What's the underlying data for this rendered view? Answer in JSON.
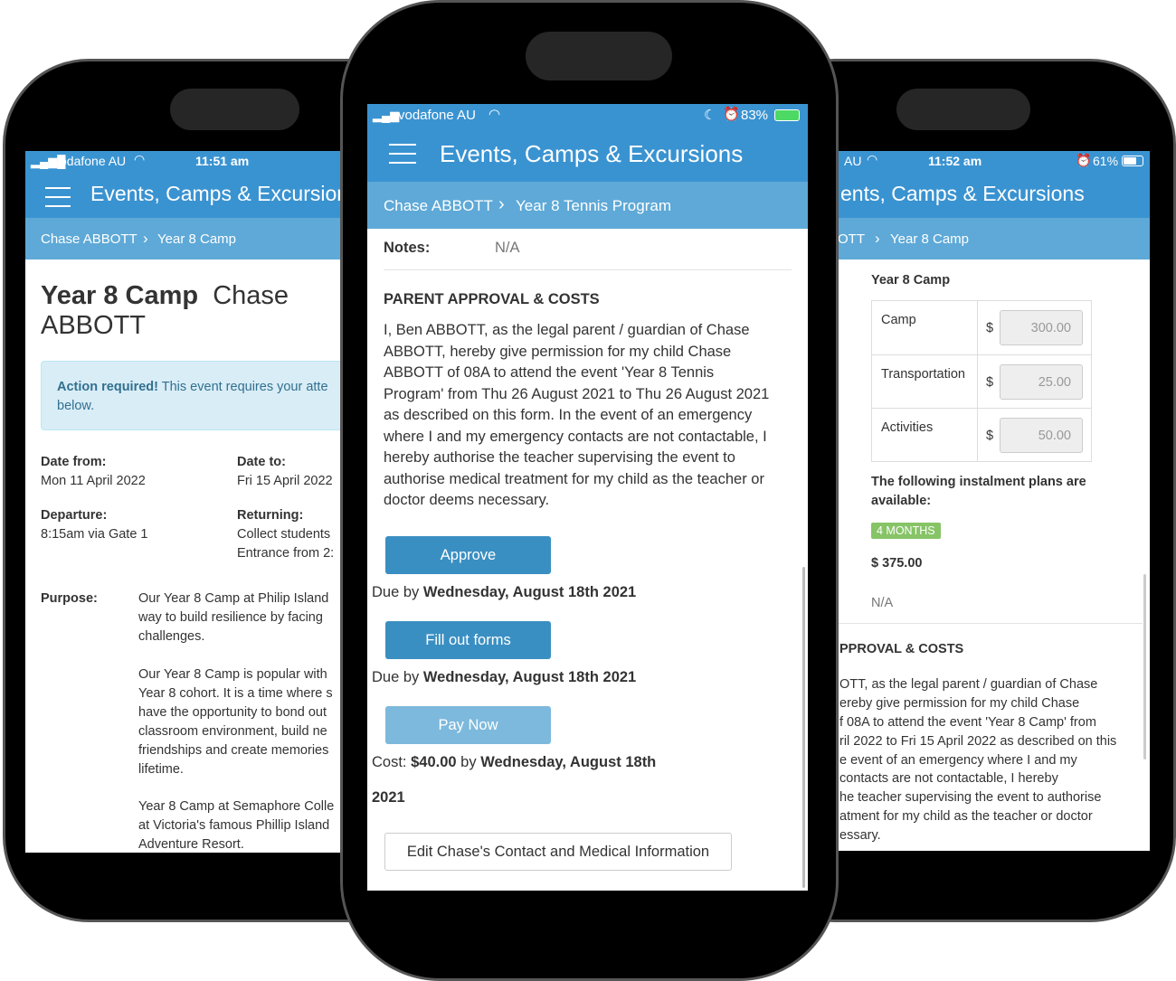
{
  "app_title": "Events, Camps & Excursions",
  "left": {
    "carrier": "vodafone AU",
    "time": "11:51 am",
    "crumb": {
      "student": "Chase ABBOTT",
      "event": "Year 8 Camp"
    },
    "title_bold": "Year 8 Camp",
    "title_name_1": "Chase",
    "title_name_2": "ABBOTT",
    "alert_bold": "Action required!",
    "alert_text": "This event requires your atte",
    "alert_text_2": "below.",
    "date_from_label": "Date from:",
    "date_from": "Mon 11 April 2022",
    "date_to_label": "Date to:",
    "date_to": "Fri 15 April 2022",
    "departure_label": "Departure:",
    "departure": "8:15am via Gate 1",
    "returning_label": "Returning:",
    "returning_1": "Collect students",
    "returning_2": "Entrance from 2:",
    "purpose_label": "Purpose:",
    "purpose_lines": [
      "Our Year 8 Camp at Philip Island",
      "way to build resilience by facing",
      "challenges.",
      "Our Year 8 Camp is popular with",
      "Year 8 cohort. It is a time where s",
      "have the opportunity to bond out",
      "classroom environment, build ne",
      "friendships and create memories",
      "lifetime.",
      "Year 8 Camp at Semaphore Colle",
      "at Victoria's famous Phillip Island",
      "Adventure Resort."
    ]
  },
  "center": {
    "carrier": "vodafone AU",
    "battery": "83%",
    "crumb": {
      "student": "Chase ABBOTT",
      "event": "Year 8 Tennis Program"
    },
    "notes_label": "Notes:",
    "notes_value": "N/A",
    "section_title": "PARENT APPROVAL & COSTS",
    "consent_lines": [
      "I, Ben ABBOTT, as the legal parent / guardian of Chase",
      "ABBOTT, hereby give permission for my child Chase",
      "ABBOTT of 08A to attend the event 'Year 8 Tennis",
      "Program' from Thu 26 August 2021 to Thu 26 August 2021",
      "as described on this form. In the event of an emergency",
      "where I and my emergency contacts are not contactable, I",
      "hereby authorise the teacher supervising the event to",
      "authorise medical treatment for my child as the teacher or",
      "doctor deems necessary."
    ],
    "approve_label": "Approve",
    "due_prefix": "Due by",
    "due_date": "Wednesday, August 18th 2021",
    "forms_label": "Fill out forms",
    "pay_label": "Pay Now",
    "cost_prefix": "Cost:",
    "cost_amount": "$40.00",
    "cost_by": "by",
    "cost_date": "Wednesday, August 18th",
    "cost_year": "2021",
    "edit_label": "Edit Chase's Contact and Medical Information"
  },
  "right": {
    "carrier": "AU",
    "time": "11:52 am",
    "battery": "61%",
    "title_fragment": "ents, Camps & Excursions",
    "crumb": {
      "student": "OTT",
      "event": "Year 8 Camp"
    },
    "costs_title": "Year 8 Camp",
    "costs": [
      {
        "label": "Camp",
        "currency": "$",
        "value": "300.00"
      },
      {
        "label": "Transportation",
        "currency": "$",
        "value": "25.00"
      },
      {
        "label": "Activities",
        "currency": "$",
        "value": "50.00"
      }
    ],
    "instalment_1": "The following instalment plans are",
    "instalment_2": "available:",
    "plan_badge": "4 MONTHS",
    "plan_total": "$ 375.00",
    "na": "N/A",
    "section_fragment": "PPROVAL & COSTS",
    "consent_lines": [
      "OTT, as the legal parent / guardian of Chase",
      "ereby give permission for my child Chase",
      "f 08A to attend the event 'Year 8 Camp' from",
      "ril 2022 to Fri 15 April 2022 as described on this",
      "e event of an emergency where I and my",
      "contacts are not contactable, I hereby",
      "he teacher supervising the event to authorise",
      "atment for my child as the teacher or doctor",
      "essary."
    ]
  },
  "colors": {
    "header": "#3a93d1",
    "breadcrumb": "#5ea9d7",
    "button": "#3a8fc2",
    "button_disabled": "#7db9dc",
    "badge": "#86c466",
    "alert_bg": "#d9edf7"
  }
}
